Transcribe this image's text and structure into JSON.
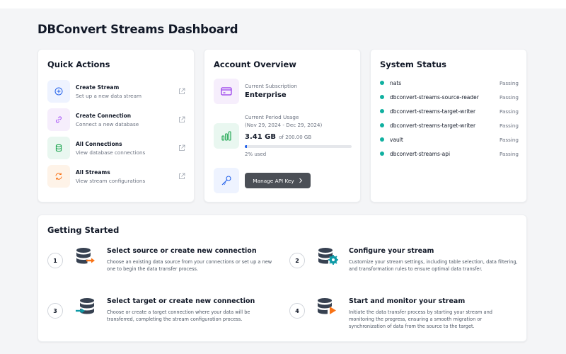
{
  "page": {
    "title": "DBConvert Streams Dashboard"
  },
  "quick_actions": {
    "title": "Quick Actions",
    "items": [
      {
        "label": "Create Stream",
        "sub": "Set up a new data stream",
        "icon": "plus-circle-icon"
      },
      {
        "label": "Create Connection",
        "sub": "Connect a new database",
        "icon": "link-icon"
      },
      {
        "label": "All Connections",
        "sub": "View database connections",
        "icon": "database-icon"
      },
      {
        "label": "All Streams",
        "sub": "View stream configurations",
        "icon": "refresh-icon"
      }
    ]
  },
  "account": {
    "title": "Account Overview",
    "subscription_label": "Current Subscription",
    "subscription_value": "Enterprise",
    "usage_label": "Current Period Usage",
    "usage_period": "(Nov 29, 2024 - Dec 29, 2024)",
    "usage_value": "3.41 GB",
    "usage_of": "of 200.00 GB",
    "usage_percent_text": "2% used",
    "usage_fraction": 0.02,
    "api_button": "Manage API Key"
  },
  "system_status": {
    "title": "System Status",
    "services": [
      {
        "name": "nats",
        "status": "Passing"
      },
      {
        "name": "dbconvert-streams-source-reader",
        "status": "Passing"
      },
      {
        "name": "dbconvert-streams-target-writer",
        "status": "Passing"
      },
      {
        "name": "dbconvert-streams-target-writer",
        "status": "Passing"
      },
      {
        "name": "vault",
        "status": "Passing"
      },
      {
        "name": "dbconvert-streams-api",
        "status": "Passing"
      }
    ],
    "status_color": "#10b0a0"
  },
  "getting_started": {
    "title": "Getting Started",
    "steps": [
      {
        "num": "1",
        "title": "Select source or create new connection",
        "desc": "Choose an existing data source from your connections or set up a new one to begin the data transfer process."
      },
      {
        "num": "2",
        "title": "Configure your stream",
        "desc": "Customize your stream settings, including table selection, data filtering, and transformation rules to ensure optimal data transfer."
      },
      {
        "num": "3",
        "title": "Select target or create new connection",
        "desc": "Choose or create a target connection where your data will be transferred, completing the stream configuration process."
      },
      {
        "num": "4",
        "title": "Start and monitor your stream",
        "desc": "Initiate the data transfer process by starting your stream and monitoring the progress, ensuring a smooth migration or synchronization of data from the source to the target."
      }
    ]
  },
  "colors": {
    "accent_blue": "#2563eb",
    "accent_orange": "#f97316",
    "accent_teal": "#0e9aa7",
    "icon_dark": "#374151"
  }
}
